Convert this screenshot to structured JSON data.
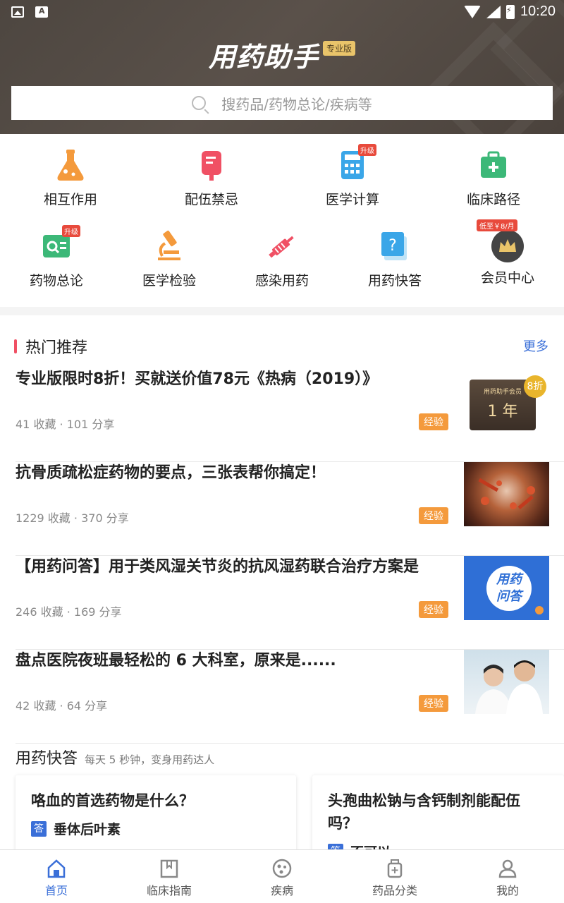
{
  "status_bar": {
    "time": "10:20"
  },
  "header": {
    "title": "用药助手",
    "badge": "专业版",
    "search_placeholder": "搜药品/药物总论/疾病等"
  },
  "grid": [
    {
      "label": "相互作用",
      "icon": "flask-icon",
      "color": "#f49a3c"
    },
    {
      "label": "配伍禁忌",
      "icon": "iv-bag-icon",
      "color": "#f05064"
    },
    {
      "label": "医学计算",
      "icon": "calculator-icon",
      "color": "#3aa6e8",
      "badge": "升级"
    },
    {
      "label": "临床路径",
      "icon": "medical-kit-icon",
      "color": "#3cb878"
    },
    {
      "label": "药物总论",
      "icon": "drug-search-icon",
      "color": "#3cb878",
      "badge": "升级"
    },
    {
      "label": "医学检验",
      "icon": "microscope-icon",
      "color": "#f49a3c"
    },
    {
      "label": "感染用药",
      "icon": "syringe-icon",
      "color": "#f05064"
    },
    {
      "label": "用药快答",
      "icon": "question-icon",
      "color": "#3aa6e8"
    },
    {
      "label": "会员中心",
      "icon": "crown-icon",
      "color": "#444",
      "badge": "低至￥8/月"
    }
  ],
  "hot": {
    "title": "热门推荐",
    "more": "更多",
    "articles": [
      {
        "title": "专业版限时8折！买就送价值78元《热病（2019）》",
        "favorites": "41 收藏",
        "shares": "101 分享",
        "tag": "经验",
        "thumb_text": "用药助手会员",
        "thumb_year": "1 年",
        "thumb_off": "8折"
      },
      {
        "title": "抗骨质疏松症药物的要点，三张表帮你搞定！",
        "favorites": "1229 收藏",
        "shares": "370 分享",
        "tag": "经验"
      },
      {
        "title": "【用药问答】用于类风湿关节炎的抗风湿药联合治疗方案是",
        "favorites": "246 收藏",
        "shares": "169 分享",
        "tag": "经验",
        "thumb_text": "用药\n问答"
      },
      {
        "title": "盘点医院夜班最轻松的 6 大科室，原来是......",
        "favorites": "42 收藏",
        "shares": "64 分享",
        "tag": "经验"
      }
    ]
  },
  "quick_answer": {
    "title": "用药快答",
    "subtitle": "每天 5 秒钟，变身用药达人",
    "answer_badge": "答",
    "cards": [
      {
        "question": "咯血的首选药物是什么？",
        "answer": "垂体后叶素"
      },
      {
        "question": "头孢曲松钠与含钙制剂能配伍吗？",
        "answer": "不可以"
      }
    ]
  },
  "nav": [
    {
      "label": "首页",
      "icon": "home-icon",
      "active": true
    },
    {
      "label": "临床指南",
      "icon": "book-icon"
    },
    {
      "label": "疾病",
      "icon": "virus-icon"
    },
    {
      "label": "药品分类",
      "icon": "medicine-bottle-icon"
    },
    {
      "label": "我的",
      "icon": "user-icon"
    }
  ],
  "colors": {
    "accent": "#3a6fd8",
    "tag": "#f49a3c",
    "header_bg": "#4d4640"
  }
}
